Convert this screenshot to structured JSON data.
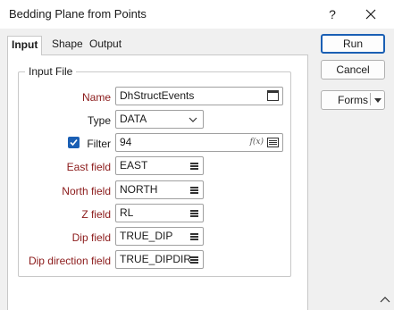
{
  "window": {
    "title": "Bedding Plane from Points",
    "help_label": "?"
  },
  "tabs": [
    {
      "label": "Input"
    },
    {
      "label": "Shape"
    },
    {
      "label": "Output"
    }
  ],
  "input_file": {
    "group_title": "Input File",
    "name_label": "Name",
    "name_value": "DhStructEvents",
    "type_label": "Type",
    "type_value": "DATA",
    "filter_label": "Filter",
    "filter_checked": true,
    "filter_value": "94",
    "filter_fx": "f(x)"
  },
  "fields": [
    {
      "label": "East field",
      "value": "EAST"
    },
    {
      "label": "North field",
      "value": "NORTH"
    },
    {
      "label": "Z field",
      "value": "RL"
    },
    {
      "label": "Dip field",
      "value": "TRUE_DIP"
    },
    {
      "label": "Dip direction field",
      "value": "TRUE_DIPDIR"
    }
  ],
  "buttons": {
    "run": "Run",
    "cancel": "Cancel",
    "forms": "Forms"
  },
  "colors": {
    "accent": "#1a5fb4",
    "label_red": "#8b1a1a"
  }
}
